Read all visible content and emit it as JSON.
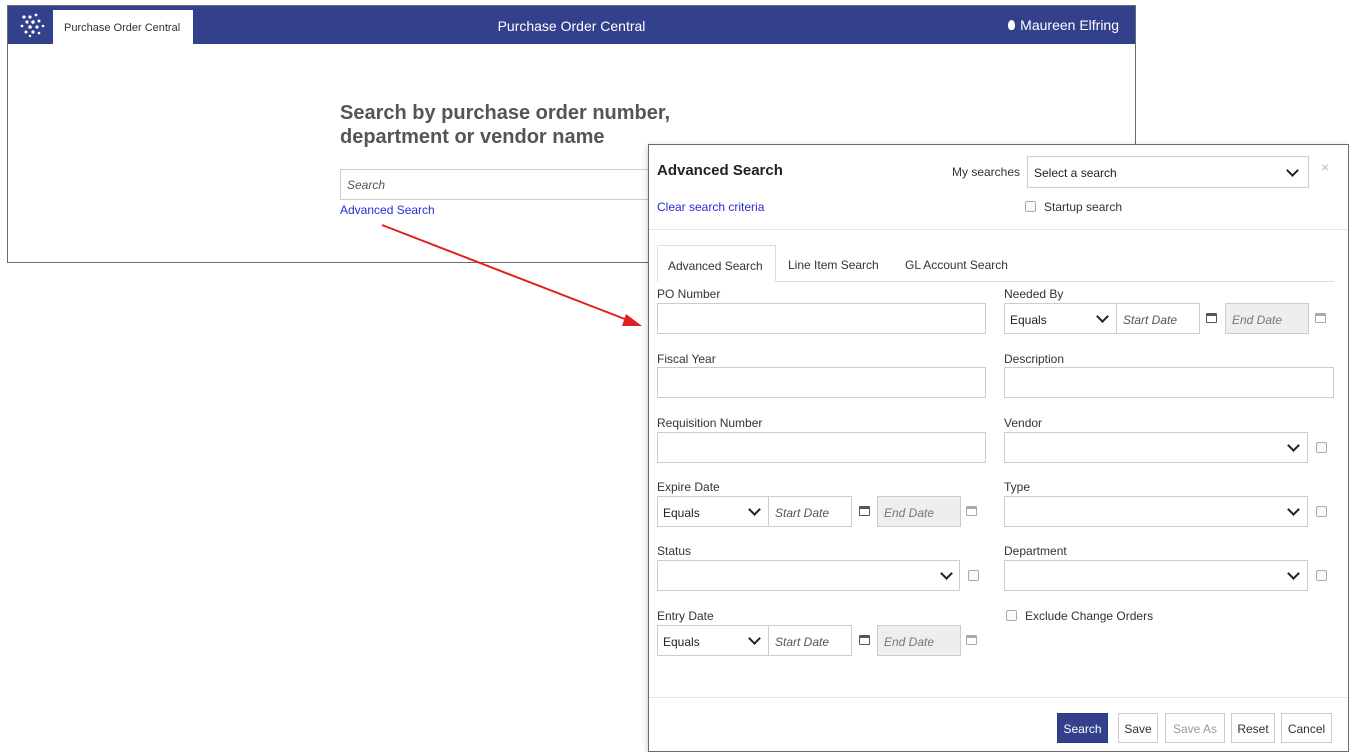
{
  "app": {
    "tab_label": "Purchase Order Central",
    "title": "Purchase Order Central",
    "user_name": "Maureen Elfring",
    "search_heading_line1": "Search by purchase order number,",
    "search_heading_line2": "department or vendor name",
    "search_placeholder": "Search",
    "advanced_search_link": "Advanced Search"
  },
  "modal": {
    "title": "Advanced Search",
    "my_searches_label": "My searches",
    "my_searches_value": "Select a search",
    "close": "×",
    "clear_link": "Clear search criteria",
    "startup_label": "Startup search",
    "tabs": [
      "Advanced Search",
      "Line Item Search",
      "GL Account Search"
    ],
    "fields": {
      "po_number": "PO Number",
      "needed_by": "Needed By",
      "fiscal_year": "Fiscal Year",
      "description": "Description",
      "requisition_number": "Requisition Number",
      "vendor": "Vendor",
      "expire_date": "Expire Date",
      "type": "Type",
      "status": "Status",
      "department": "Department",
      "entry_date": "Entry Date",
      "exclude_change_orders": "Exclude Change Orders"
    },
    "operator_value": "Equals",
    "start_date_placeholder": "Start Date",
    "end_date_placeholder": "End Date",
    "buttons": {
      "search": "Search",
      "save": "Save",
      "save_as": "Save As",
      "reset": "Reset",
      "cancel": "Cancel"
    }
  },
  "colors": {
    "header_bg": "#33418c",
    "link": "#2a2ad6",
    "arrow": "#e02020"
  }
}
